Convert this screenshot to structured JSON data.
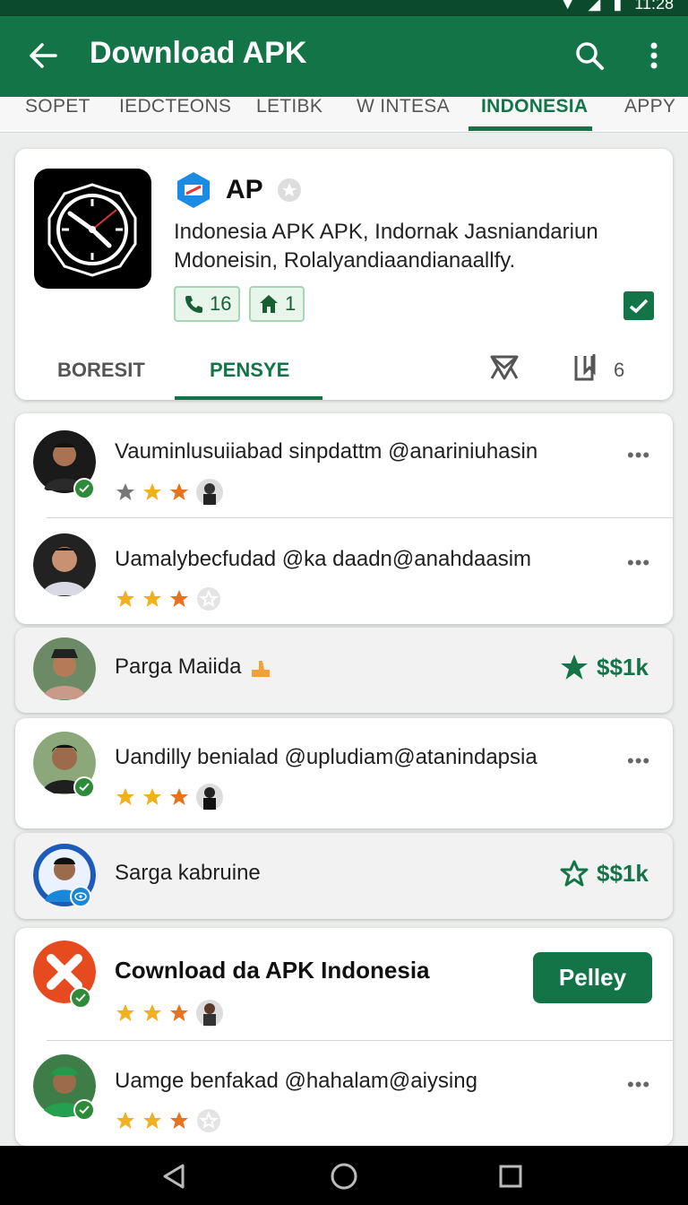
{
  "status": {
    "time": "11:28"
  },
  "appbar": {
    "title": "Download APK"
  },
  "tabs": [
    "SOPET",
    "IEDCTEONS",
    "LETIBK",
    "W INTESA",
    "INDONESIA",
    "APPY"
  ],
  "app": {
    "name": "AP",
    "description_line1": "Indonesia APK  APK, Indornak Jasniandariun",
    "description_line2": "Mdoneisin, Rolalyandiaandianaallfy.",
    "chip_calls": "16",
    "chip_home": "1",
    "subtabs": [
      "BORESIT",
      "PENSYE"
    ],
    "share_count": "6"
  },
  "reviews": [
    {
      "text": "Vauminlusuiiabad sinpdattm @anariniuhasin",
      "more": "•••"
    },
    {
      "text": "Uamalybecfudad @ka daadn@anahdaasim",
      "more": "•••"
    },
    {
      "text": "Parga Maiida",
      "price": "$$1k"
    },
    {
      "text": "Uandilly benialad @upludiam@atanindapsia",
      "more": "•••"
    },
    {
      "text": "Sarga kabruine",
      "price": "$$1k"
    },
    {
      "text": "Cownload da APK Indonesia",
      "button": "Pelley"
    },
    {
      "text": "Uamge benfakad @hahalam@aiysing",
      "more": "•••"
    }
  ],
  "colors": {
    "primary": "#137547",
    "status": "#0c4a2c",
    "star": "#f2b01e",
    "star_orange": "#e8731f"
  }
}
